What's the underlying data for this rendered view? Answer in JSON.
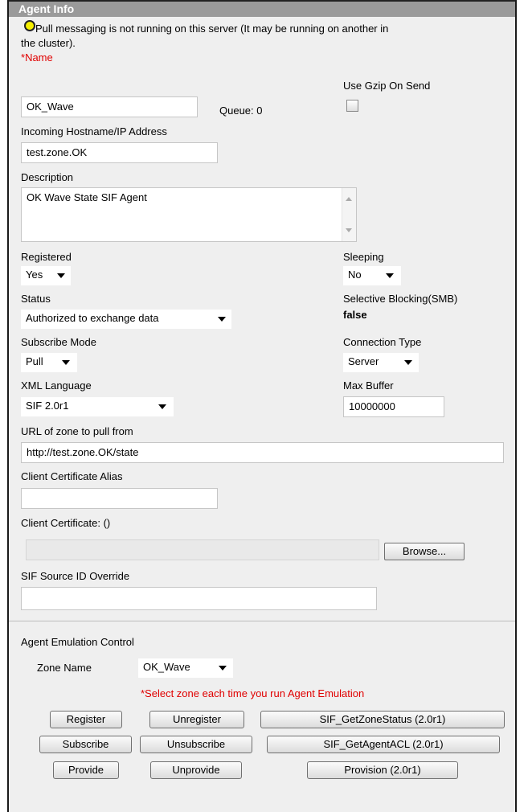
{
  "panel": {
    "title": "Agent Info"
  },
  "status_message": {
    "icon": "status-bulb-icon",
    "text_line1": "Pull messaging is not running on this server (It may be running on another in",
    "text_line2": "the cluster)."
  },
  "name": {
    "required_marker": "*",
    "label": "Name",
    "value": "OK_Wave"
  },
  "queue": {
    "text": "Queue: 0"
  },
  "gzip": {
    "label": "Use Gzip On Send",
    "checked": false
  },
  "hostname": {
    "label": "Incoming Hostname/IP Address",
    "value": "test.zone.OK"
  },
  "description": {
    "label": "Description",
    "value": "OK Wave State SIF Agent"
  },
  "registered": {
    "label": "Registered",
    "value": "Yes"
  },
  "sleeping": {
    "label": "Sleeping",
    "value": "No"
  },
  "status": {
    "label": "Status",
    "value": "Authorized to exchange data"
  },
  "smb": {
    "label": "Selective Blocking(SMB)",
    "value": "false"
  },
  "subscribe_mode": {
    "label": "Subscribe Mode",
    "value": "Pull"
  },
  "connection_type": {
    "label": "Connection Type",
    "value": "Server"
  },
  "xml_language": {
    "label": "XML Language",
    "value": "SIF 2.0r1"
  },
  "max_buffer": {
    "label": "Max Buffer",
    "value": "10000000"
  },
  "pull_url": {
    "label": "URL of zone to pull from",
    "value": "http://test.zone.OK/state"
  },
  "cert_alias": {
    "label": "Client Certificate Alias",
    "value": ""
  },
  "client_cert": {
    "label": "Client Certificate: ()",
    "browse_label": "Browse..."
  },
  "source_id": {
    "label": "SIF Source ID Override",
    "value": ""
  },
  "emulation": {
    "title": "Agent Emulation Control",
    "zone_label": "Zone Name",
    "zone_value": "OK_Wave",
    "notice": "*Select zone each time you run Agent Emulation",
    "buttons": {
      "register": "Register",
      "unregister": "Unregister",
      "get_zone_status": "SIF_GetZoneStatus (2.0r1)",
      "subscribe": "Subscribe",
      "unsubscribe": "Unsubscribe",
      "get_agent_acl": "SIF_GetAgentACL (2.0r1)",
      "provide": "Provide",
      "unprovide": "Unprovide",
      "provision": "Provision (2.0r1)"
    }
  },
  "colors": {
    "required": "#e00000",
    "header_bg": "#9a9a9a",
    "panel_bg": "#efefef",
    "bulb": "#f6f000"
  }
}
